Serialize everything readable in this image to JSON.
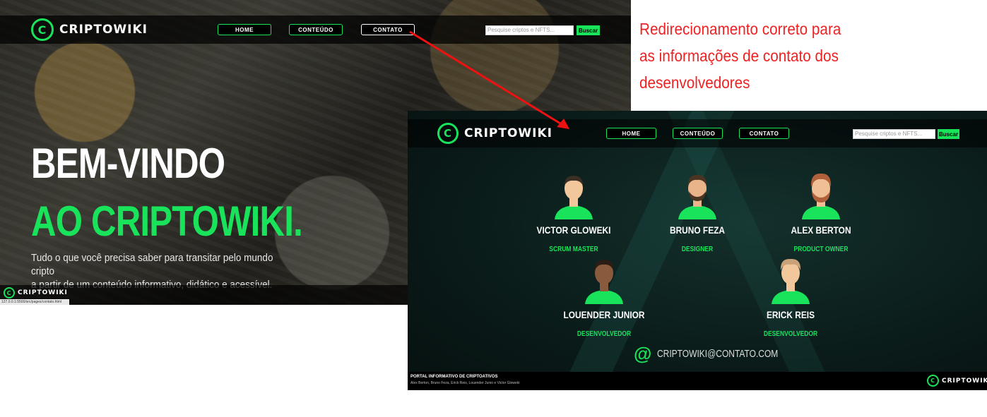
{
  "brand": {
    "name": "CRIPTOWIKI",
    "logo_letter": "C",
    "accent": "#19e35a"
  },
  "nav": {
    "items": [
      "HOME",
      "CONTEÚDO",
      "CONTATO"
    ],
    "active": "CONTATO"
  },
  "search": {
    "placeholder": "Pesquise criptos e NFTS...",
    "button": "Buscar"
  },
  "home": {
    "title_line1": "BEM-VINDO",
    "title_line2": "AO CRIPTOWIKI.",
    "subtitle_line1": "Tudo o que você precisa saber para transitar pelo mundo cripto",
    "subtitle_line2": "a partir de um conteúdo informativo, didático e acessível.",
    "status_url": "127.0.0.1:5500/src/pages/contato.html"
  },
  "annotation": {
    "line1": "Redirecionamento correto para",
    "line2": "as informações de contato dos",
    "line3": "desenvolvedores",
    "color": "#ee2222"
  },
  "contact": {
    "team": [
      {
        "name": "VICTOR GLOWEKI",
        "role": "SCRUM MASTER"
      },
      {
        "name": "BRUNO FEZA",
        "role": "DESIGNER"
      },
      {
        "name": "ALEX BERTON",
        "role": "PRODUCT OWNER"
      },
      {
        "name": "LOUENDER JUNIOR",
        "role": "DESENVOLVEDOR"
      },
      {
        "name": "ERICK REIS",
        "role": "DESENVOLVEDOR"
      }
    ],
    "email_symbol": "@",
    "email": "CRIPTOWIKI@CONTATO.COM",
    "footer_title": "PORTAL INFORMATIVO DE CRIPTOATIVOS",
    "footer_authors": "Alex Berton, Bruno Feza, Erick Reis, Louender Junio e Victor Gloweki"
  }
}
